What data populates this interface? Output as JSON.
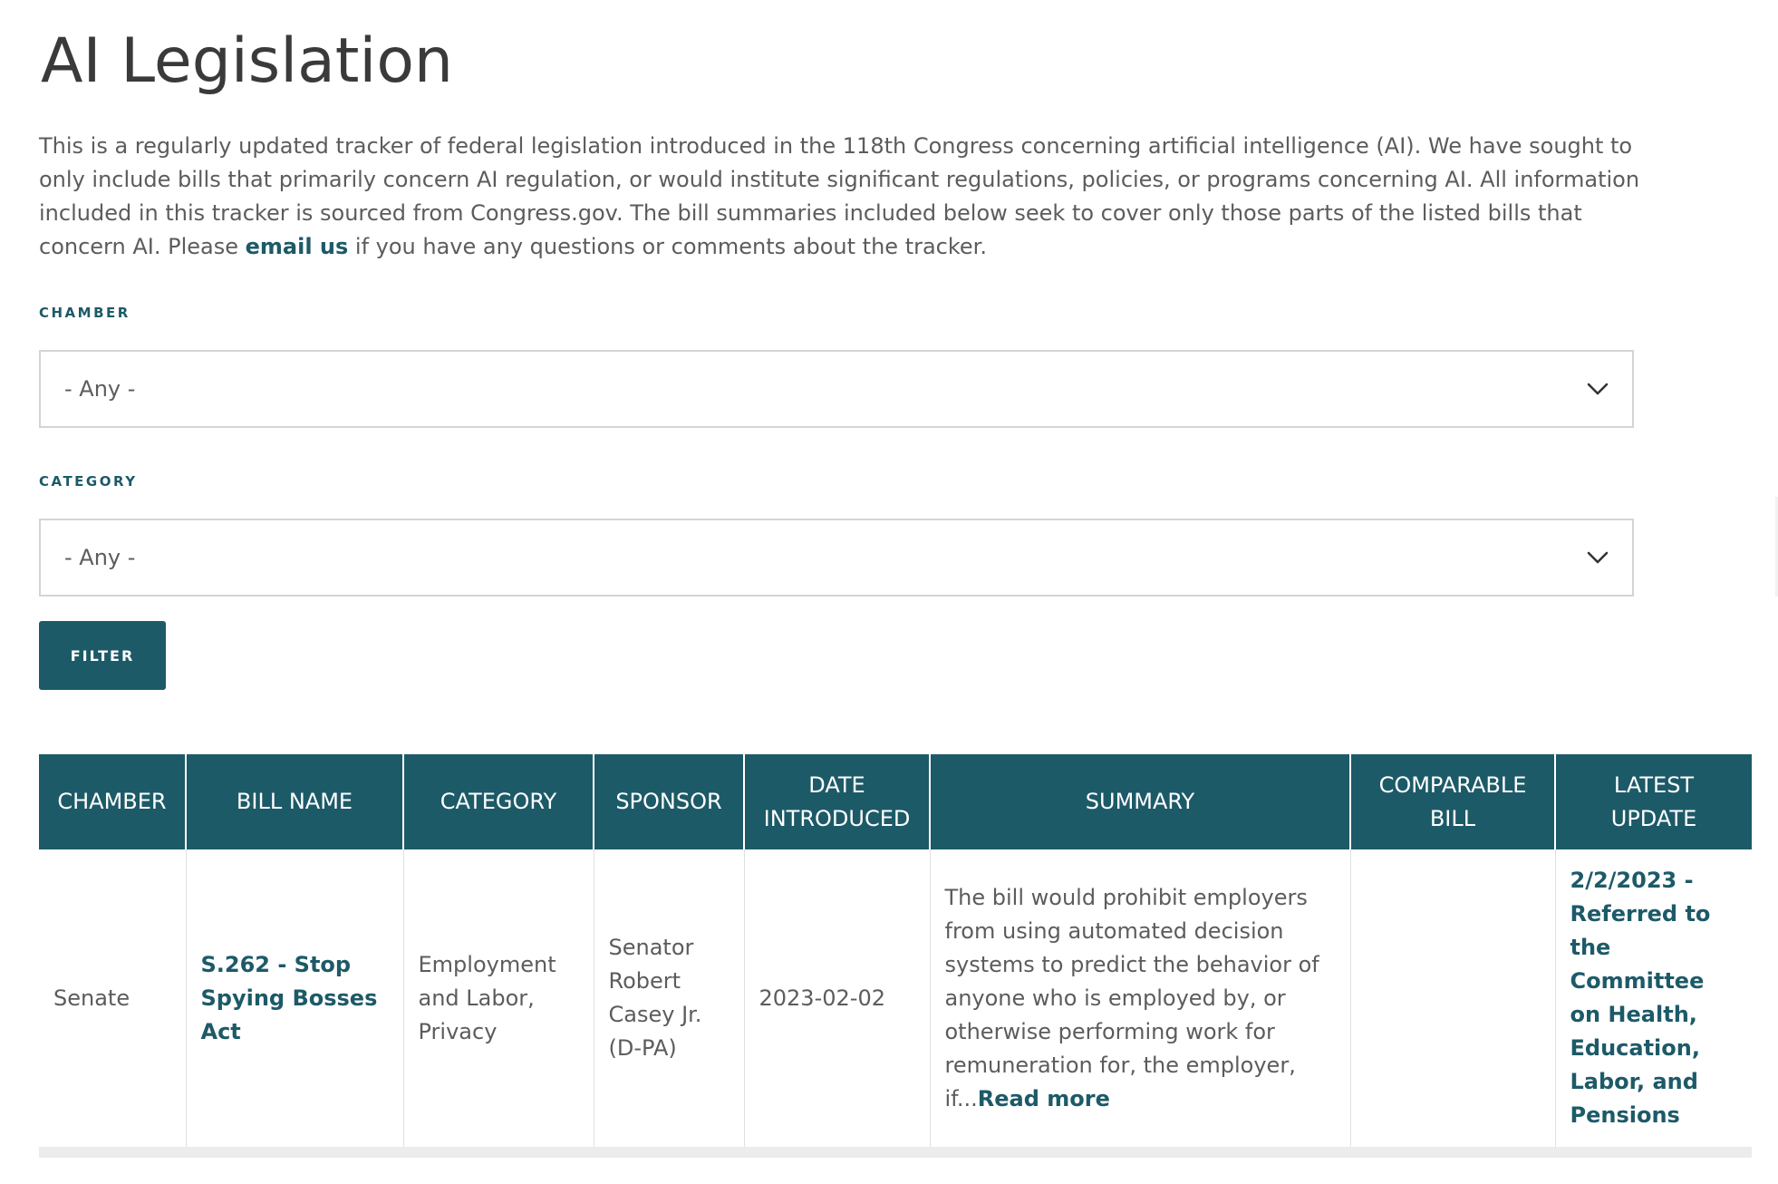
{
  "page": {
    "title": "AI Legislation",
    "intro_before_link": "This is a regularly updated tracker of federal legislation introduced in the 118th Congress concerning artificial intelligence (AI). We have sought to only include bills that primarily concern AI regulation, or would institute significant regulations, policies, or programs concerning AI. All information included in this tracker is sourced from Congress.gov. The bill summaries included below seek to cover only those parts of the listed bills that concern AI. Please ",
    "intro_link": "email us",
    "intro_after_link": " if you have any questions or comments about the tracker."
  },
  "filters": {
    "chamber_label": "CHAMBER",
    "chamber_value": "- Any -",
    "category_label": "CATEGORY",
    "category_value": "- Any -",
    "filter_button": "FILTER"
  },
  "table": {
    "headers": {
      "chamber": "CHAMBER",
      "bill_name": "BILL NAME",
      "category": "CATEGORY",
      "sponsor": "SPONSOR",
      "date_introduced": "DATE INTRODUCED",
      "summary": "SUMMARY",
      "comparable_bill": "COMPARABLE BILL",
      "latest_update": "LATEST UPDATE"
    },
    "rows": [
      {
        "chamber": "Senate",
        "bill_name": "S.262 - Stop Spying Bosses Act",
        "category": "Employment and Labor, Privacy",
        "sponsor": "Senator Robert Casey Jr. (D-PA)",
        "date_introduced": "2023-02-02",
        "summary": "The bill would prohibit employers from using automated decision systems to predict the behavior of anyone who is employed by, or otherwise performing work for remuneration for, the employer, if...",
        "read_more": "Read more",
        "comparable_bill": "",
        "latest_update": "2/2/2023 - Referred to the Committee on Health, Education, Labor, and Pensions"
      }
    ]
  },
  "colors": {
    "accent": "#1d5a68",
    "text": "#5c5c5c",
    "title": "#3a3a3a",
    "border": "#d4d4d4"
  },
  "icons": {
    "select_arrow": "chevron-down-icon"
  }
}
